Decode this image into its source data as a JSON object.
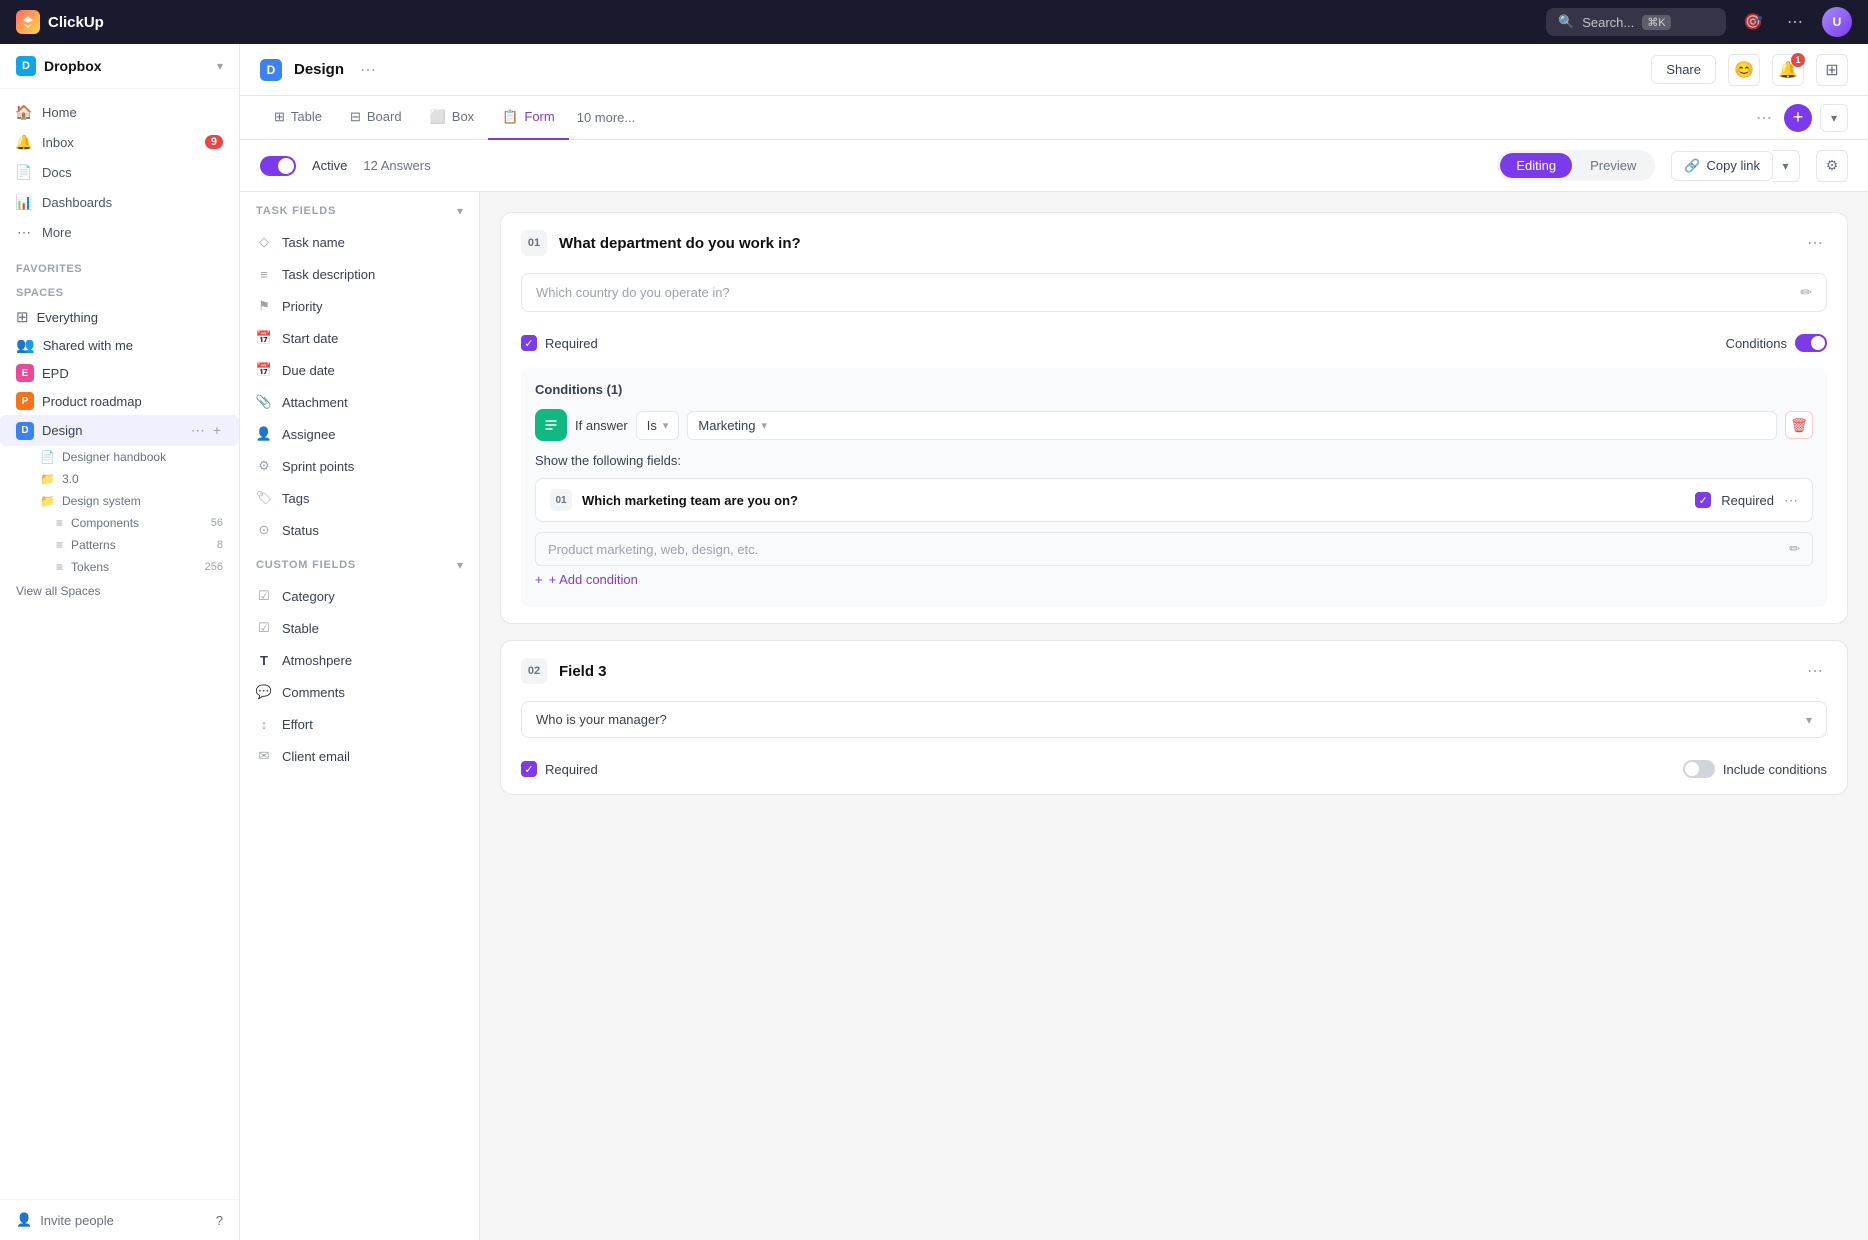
{
  "app": {
    "name": "ClickUp",
    "logo_text": "C"
  },
  "topnav": {
    "search_placeholder": "Search...",
    "search_shortcut": "⌘K",
    "icons": [
      "target-icon",
      "grid-icon"
    ]
  },
  "sidebar": {
    "workspace": {
      "name": "Dropbox",
      "icon": "D",
      "icon_color": "#0ea5e9"
    },
    "nav_items": [
      {
        "id": "home",
        "label": "Home",
        "icon": "🏠"
      },
      {
        "id": "inbox",
        "label": "Inbox",
        "icon": "🔔",
        "badge": "9"
      },
      {
        "id": "docs",
        "label": "Docs",
        "icon": "📄"
      },
      {
        "id": "dashboards",
        "label": "Dashboards",
        "icon": "📊"
      },
      {
        "id": "more",
        "label": "More",
        "icon": "⋯"
      }
    ],
    "section_favorites": "FAVORITES",
    "section_spaces": "SPACES",
    "spaces": [
      {
        "id": "everything",
        "label": "Everything",
        "icon": "⊞",
        "color": "#6b7280"
      },
      {
        "id": "shared",
        "label": "Shared with me",
        "icon": "👥",
        "color": "#6b7280"
      },
      {
        "id": "epd",
        "label": "EPD",
        "initial": "E",
        "color": "#ec4899"
      },
      {
        "id": "product-roadmap",
        "label": "Product roadmap",
        "initial": "P",
        "color": "#f97316"
      },
      {
        "id": "design",
        "label": "Design",
        "initial": "D",
        "color": "#3b82f6",
        "active": true
      }
    ],
    "sub_items": [
      {
        "id": "designer-handbook",
        "label": "Designer handbook",
        "icon": "📄"
      },
      {
        "id": "3.0",
        "label": "3.0",
        "icon": "📁"
      },
      {
        "id": "design-system",
        "label": "Design system",
        "icon": "📁"
      }
    ],
    "sub_sub_items": [
      {
        "id": "components",
        "label": "Components",
        "count": "56"
      },
      {
        "id": "patterns",
        "label": "Patterns",
        "count": "8"
      },
      {
        "id": "tokens",
        "label": "Tokens",
        "count": "256"
      }
    ],
    "view_all_spaces": "View all Spaces",
    "invite_people": "Invite people"
  },
  "page_header": {
    "icon": "D",
    "title": "Design",
    "share_label": "Share"
  },
  "tabs": {
    "items": [
      {
        "id": "table",
        "label": "Table",
        "icon": "⊞",
        "active": false
      },
      {
        "id": "board",
        "label": "Board",
        "icon": "⊟",
        "active": false
      },
      {
        "id": "box",
        "label": "Box",
        "icon": "⬜",
        "active": false
      },
      {
        "id": "form",
        "label": "Form",
        "icon": "📋",
        "active": true
      }
    ],
    "more_label": "10 more..."
  },
  "form_toolbar": {
    "active_label": "Active",
    "answers_label": "12 Answers",
    "editing_label": "Editing",
    "preview_label": "Preview",
    "copy_link_label": "Copy link"
  },
  "left_panel": {
    "task_fields_section": "TASK FIELDS",
    "task_fields": [
      {
        "id": "task-name",
        "label": "Task name",
        "icon": "◇"
      },
      {
        "id": "task-description",
        "label": "Task description",
        "icon": "≡"
      },
      {
        "id": "priority",
        "label": "Priority",
        "icon": "⚑"
      },
      {
        "id": "start-date",
        "label": "Start date",
        "icon": "📅"
      },
      {
        "id": "due-date",
        "label": "Due date",
        "icon": "📅"
      },
      {
        "id": "attachment",
        "label": "Attachment",
        "icon": "📎"
      },
      {
        "id": "assignee",
        "label": "Assignee",
        "icon": "👤"
      },
      {
        "id": "sprint-points",
        "label": "Sprint points",
        "icon": "⚙"
      },
      {
        "id": "tags",
        "label": "Tags",
        "icon": "🏷"
      },
      {
        "id": "status",
        "label": "Status",
        "icon": "⊙"
      }
    ],
    "custom_fields_section": "CUSTOM FIELDS",
    "custom_fields": [
      {
        "id": "category",
        "label": "Category",
        "icon": "☑"
      },
      {
        "id": "stable",
        "label": "Stable",
        "icon": "☑"
      },
      {
        "id": "atmoshpere",
        "label": "Atmoshpere",
        "icon": "T"
      },
      {
        "id": "comments",
        "label": "Comments",
        "icon": "💬"
      },
      {
        "id": "effort",
        "label": "Effort",
        "icon": "↕"
      },
      {
        "id": "client-email",
        "label": "Client email",
        "icon": "✉"
      }
    ]
  },
  "form_fields": {
    "field1": {
      "number": "01",
      "title": "What department do you work in?",
      "placeholder": "Which country do you operate in?",
      "required": true,
      "conditions_toggle": true,
      "conditions_title": "Conditions (1)",
      "condition": {
        "icon": "↕",
        "if_label": "If answer",
        "operator": "Is",
        "value": "Marketing",
        "show_label": "Show the following fields:",
        "sub_field_number": "01",
        "sub_field_title": "Which marketing team are you on?",
        "sub_field_required": true,
        "sub_field_placeholder": "Product marketing, web, design, etc.",
        "add_condition_label": "+ Add condition"
      }
    },
    "field2": {
      "number": "02",
      "title": "Field 3",
      "select_placeholder": "Who is your manager?",
      "required": true,
      "include_conditions_toggle": false,
      "include_conditions_label": "Include conditions"
    }
  }
}
